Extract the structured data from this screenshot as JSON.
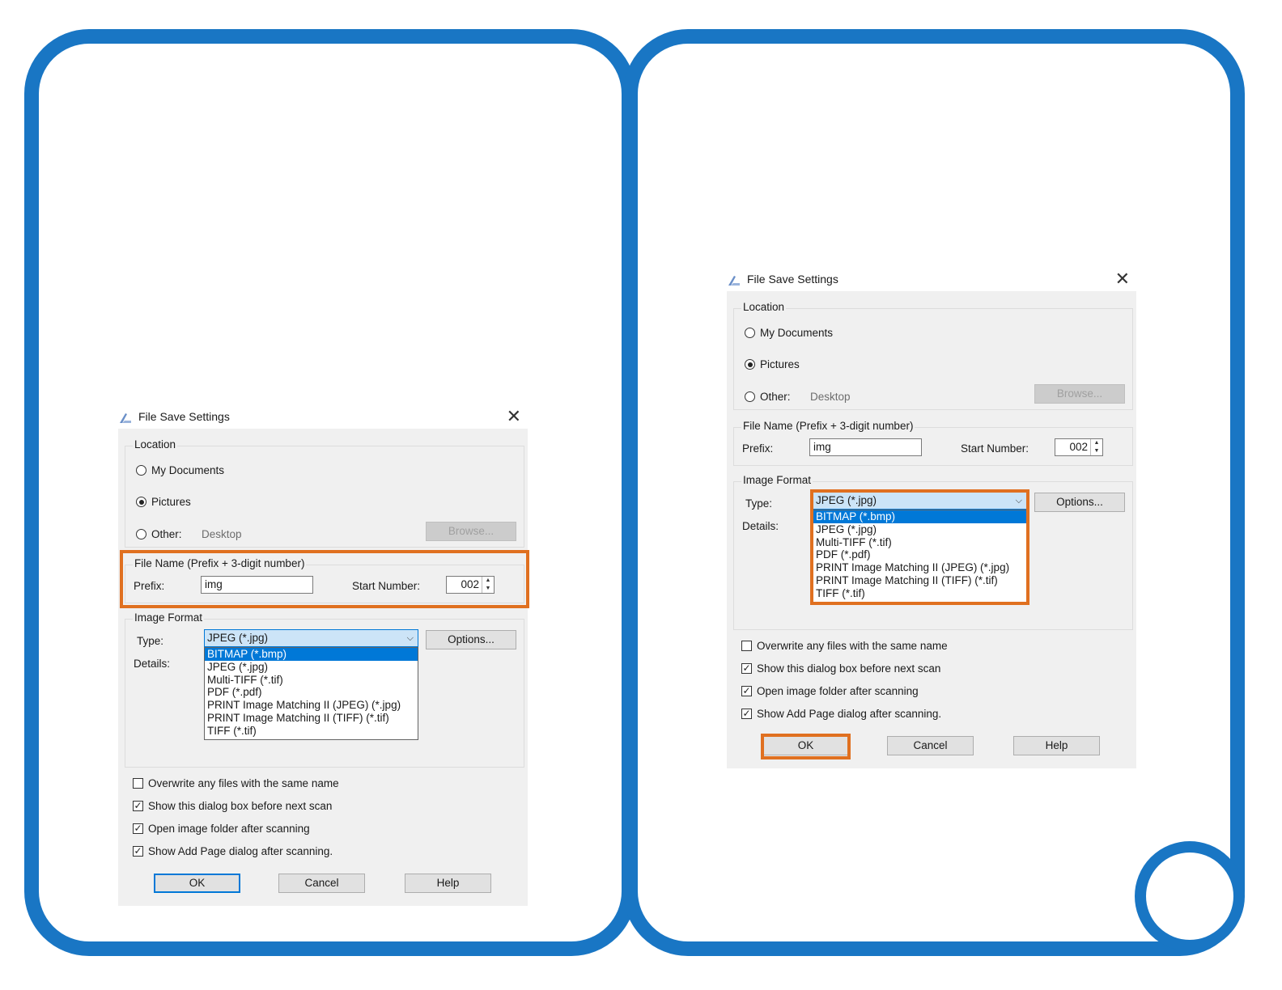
{
  "dialog": {
    "title": "File Save Settings",
    "close_glyph": "✕",
    "location": {
      "legend": "Location",
      "my_documents": "My Documents",
      "pictures": "Pictures",
      "other": "Other:",
      "other_path": "Desktop",
      "browse": "Browse...",
      "selected": "Pictures"
    },
    "file_name": {
      "legend": "File Name (Prefix + 3-digit number)",
      "prefix_label": "Prefix:",
      "prefix_value": "img",
      "start_label": "Start Number:",
      "start_value": "002"
    },
    "image_format": {
      "legend": "Image Format",
      "type_label": "Type:",
      "type_value": "JPEG (*.jpg)",
      "details_label": "Details:",
      "options_button": "Options...",
      "type_options": [
        "BITMAP (*.bmp)",
        "JPEG (*.jpg)",
        "Multi-TIFF (*.tif)",
        "PDF (*.pdf)",
        "PRINT Image Matching II (JPEG) (*.jpg)",
        "PRINT Image Matching II (TIFF) (*.tif)",
        "TIFF (*.tif)"
      ],
      "highlighted_option": "BITMAP (*.bmp)"
    },
    "checkboxes": [
      {
        "label": "Overwrite any files with the same name",
        "checked": false
      },
      {
        "label": "Show this dialog box before next scan",
        "checked": true
      },
      {
        "label": "Open image folder after scanning",
        "checked": true
      },
      {
        "label": "Show Add Page dialog after scanning.",
        "checked": true
      }
    ],
    "buttons": {
      "ok": "OK",
      "cancel": "Cancel",
      "help": "Help"
    }
  },
  "colors": {
    "frame": "#1976c4",
    "highlight": "#e07020",
    "selection": "#0078d7"
  }
}
